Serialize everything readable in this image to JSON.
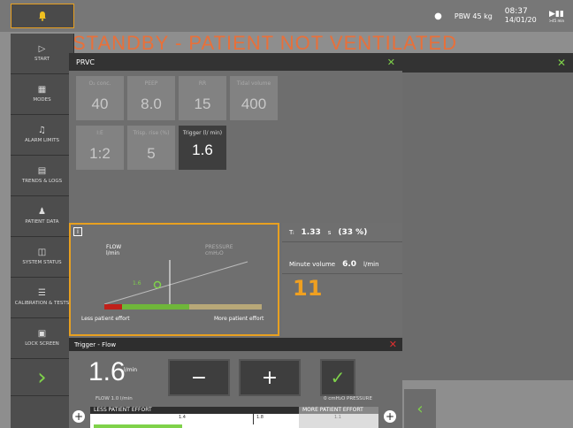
{
  "topbar": {
    "pbw_label": "PBW 45 kg",
    "time": "08:37",
    "date": "14/01/20",
    "battery_label": ">45 min"
  },
  "banner": "STANDBY - PATIENT NOT VENTILATED",
  "sidebar": {
    "items": [
      {
        "label": "START",
        "icon": "play-icon"
      },
      {
        "label": "MODES",
        "icon": "grid-icon"
      },
      {
        "label": "ALARM LIMITS",
        "icon": "alarm-icon"
      },
      {
        "label": "TRENDS & LOGS",
        "icon": "trends-icon"
      },
      {
        "label": "PATIENT DATA",
        "icon": "patient-icon"
      },
      {
        "label": "SYSTEM STATUS",
        "icon": "system-icon"
      },
      {
        "label": "CALIBRATION & TESTS",
        "icon": "calibration-icon"
      },
      {
        "label": "LOCK SCREEN",
        "icon": "lock-icon"
      }
    ],
    "next_glyph": "›"
  },
  "dialog": {
    "title": "PRVC",
    "tiles": [
      {
        "label": "O₂ conc.",
        "value": "40"
      },
      {
        "label": "PEEP",
        "value": "8.0"
      },
      {
        "label": "RR",
        "value": "15"
      },
      {
        "label": "Tidal volume",
        "value": "400"
      },
      {
        "label": "I:E",
        "value": "1:2"
      },
      {
        "label": "Trisp. rise (%)",
        "value": "5"
      },
      {
        "label": "Trigger (l/ min)",
        "value": "1.6"
      }
    ],
    "graph": {
      "flow_label": "FLOW",
      "flow_unit": "l/min",
      "pressure_label": "PRESSURE",
      "pressure_unit": "cmH₂O",
      "marker_value": "1.6",
      "less_label": "Less patient effort",
      "more_label": "More patient effort"
    },
    "metrics": {
      "ti_label": "Tᵢ",
      "ti_value": "1.33",
      "ti_unit": "s",
      "ti_pct": "(33 %)",
      "mv_label": "Minute volume",
      "mv_value": "6.0",
      "mv_unit": "l/min",
      "big_value": "11"
    }
  },
  "trigger": {
    "title": "Trigger - Flow",
    "value": "1.6",
    "unit": "l/min",
    "minus": "−",
    "plus": "+",
    "flow_note": "FLOW 1.0 l/min",
    "pressure_note": "0 cmH₂O PRESSURE",
    "less": "LESS PATIENT EFFORT",
    "more": "MORE PATIENT EFFORT",
    "ticks": [
      "1.4",
      "1.8",
      "1.1"
    ]
  },
  "colors": {
    "accent": "#7fd24a",
    "warning": "#e8703a",
    "highlight": "#e8a020",
    "close_red": "#e03030"
  }
}
